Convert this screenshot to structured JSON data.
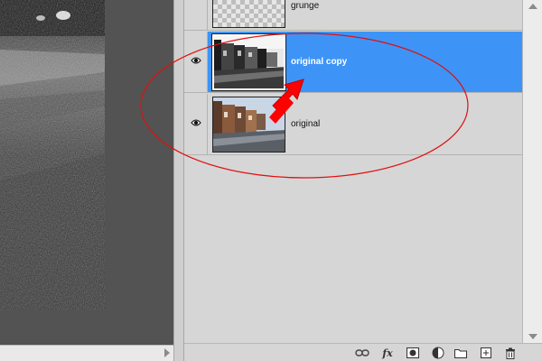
{
  "layers": [
    {
      "name": "grunge",
      "visible": false,
      "selected": false
    },
    {
      "name": "original copy",
      "visible": true,
      "selected": true
    },
    {
      "name": "original",
      "visible": true,
      "selected": false
    }
  ],
  "toolbar": {
    "fx_label": "fx",
    "icons": [
      "link-layers-icon",
      "layer-style-icon",
      "layer-mask-icon",
      "adjustment-layer-icon",
      "new-group-icon",
      "new-layer-icon",
      "delete-layer-icon"
    ]
  },
  "colors": {
    "selection": "#3d94f6",
    "annotation": "#e01010",
    "panel_bg": "#d6d6d6",
    "canvas_bg": "#535353"
  }
}
